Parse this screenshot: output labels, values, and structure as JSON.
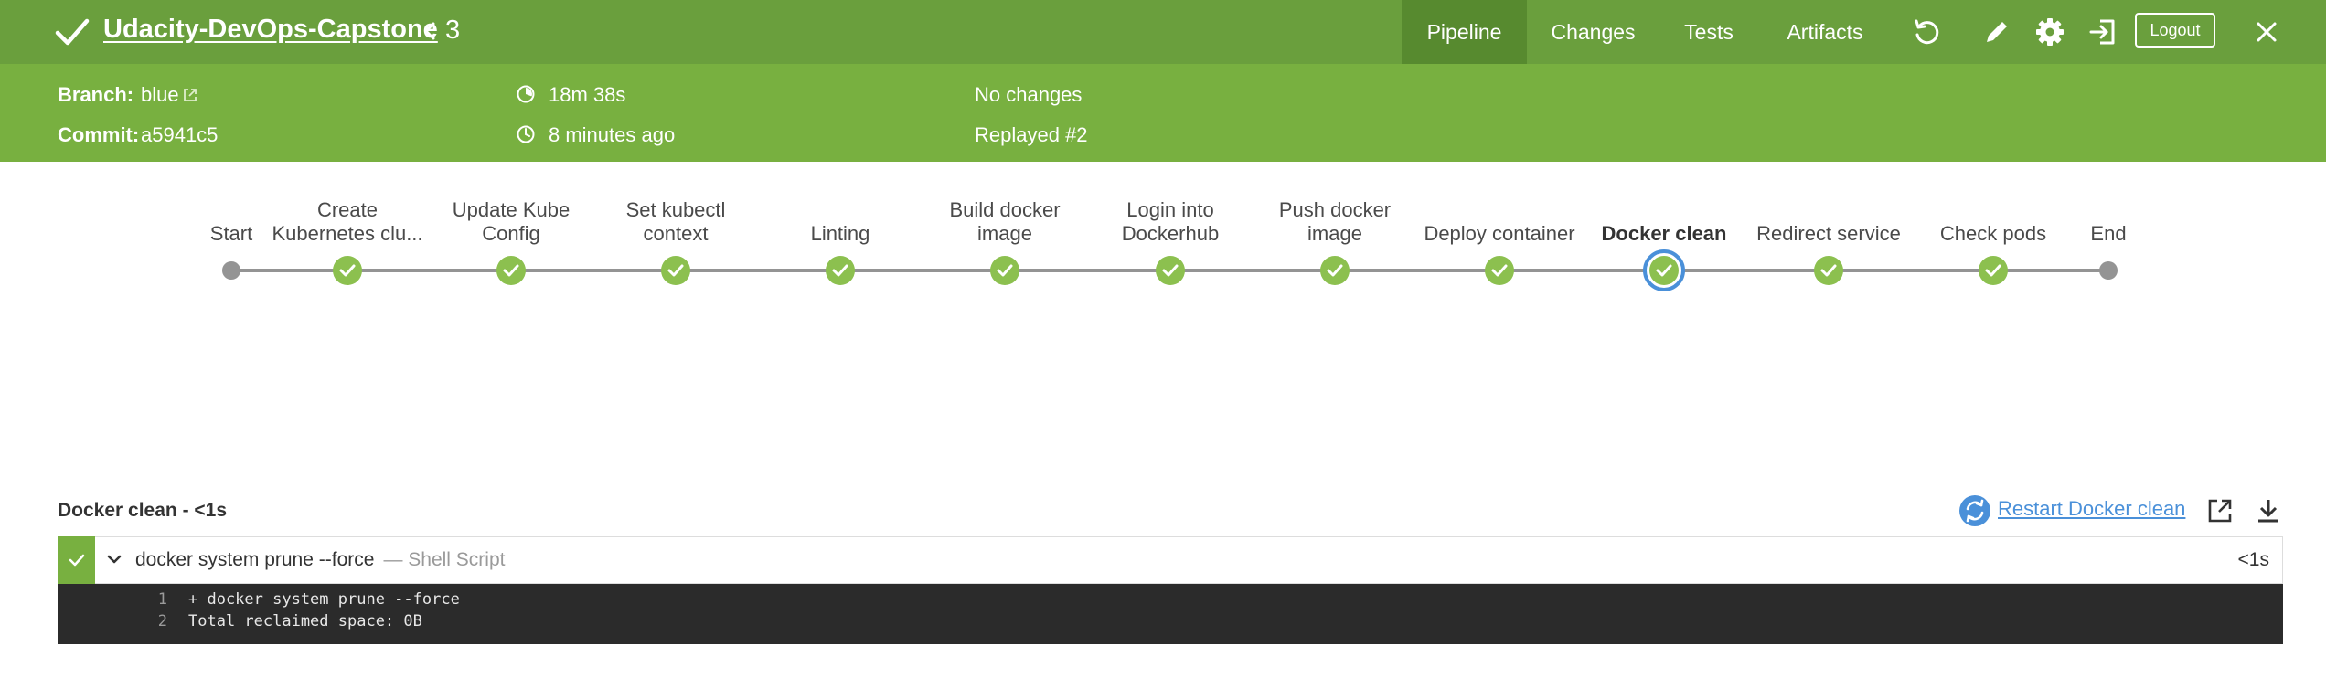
{
  "header": {
    "title": "Udacity-DevOps-Capstone",
    "run_number": "3",
    "tabs": [
      {
        "label": "Pipeline",
        "active": true
      },
      {
        "label": "Changes",
        "active": false
      },
      {
        "label": "Tests",
        "active": false
      },
      {
        "label": "Artifacts",
        "active": false
      }
    ],
    "logout_label": "Logout",
    "icons": [
      "check-icon",
      "chevron-left-icon",
      "replay-icon",
      "edit-icon",
      "gear-icon",
      "exit-icon",
      "close-icon"
    ],
    "colors": {
      "header_bg": "#6a9f3d",
      "active_tab_bg": "#578a2f",
      "subheader_bg": "#78b040"
    }
  },
  "summary": {
    "branch_label": "Branch:",
    "branch_value": "blue",
    "commit_label": "Commit:",
    "commit_value": "a5941c5",
    "duration": "18m 38s",
    "finished": "8 minutes ago",
    "changes": "No changes",
    "replayed": "Replayed #2"
  },
  "pipeline": {
    "stages": [
      {
        "line1": "Start",
        "line2": "",
        "status": "endpoint"
      },
      {
        "line1": "Create",
        "line2": "Kubernetes clu...",
        "status": "success"
      },
      {
        "line1": "Update Kube",
        "line2": "Config",
        "status": "success"
      },
      {
        "line1": "Set kubectl",
        "line2": "context",
        "status": "success"
      },
      {
        "line1": "Linting",
        "line2": "",
        "status": "success"
      },
      {
        "line1": "Build docker",
        "line2": "image",
        "status": "success"
      },
      {
        "line1": "Login into",
        "line2": "Dockerhub",
        "status": "success"
      },
      {
        "line1": "Push docker",
        "line2": "image",
        "status": "success"
      },
      {
        "line1": "Deploy container",
        "line2": "",
        "status": "success"
      },
      {
        "line1": "Docker clean",
        "line2": "",
        "status": "success",
        "selected": true
      },
      {
        "line1": "Redirect service",
        "line2": "",
        "status": "success"
      },
      {
        "line1": "Check pods",
        "line2": "",
        "status": "success"
      },
      {
        "line1": "End",
        "line2": "",
        "status": "endpoint"
      }
    ],
    "colors": {
      "success": "#8cc04f",
      "selected_ring": "#4a90d9",
      "endpoint": "#949494"
    }
  },
  "step_panel": {
    "title": "Docker clean - <1s",
    "restart_label": "Restart Docker clean",
    "step": {
      "command": "docker system prune --force",
      "kind": "— Shell Script",
      "duration": "<1s"
    },
    "log": [
      {
        "num": "1",
        "text": "+ docker system prune --force"
      },
      {
        "num": "2",
        "text": "Total reclaimed space: 0B"
      }
    ]
  }
}
